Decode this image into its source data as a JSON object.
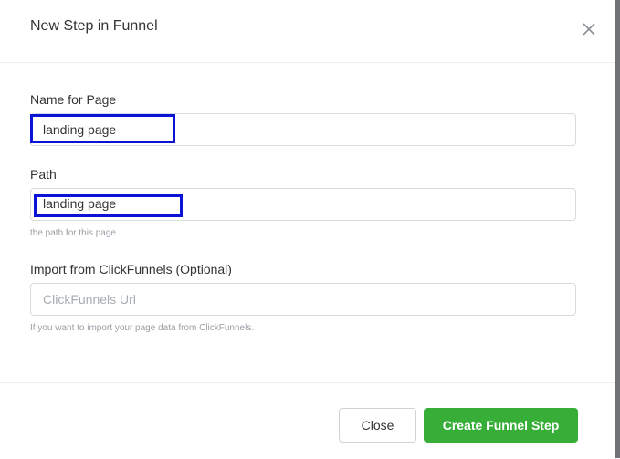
{
  "dialog": {
    "title": "New Step in Funnel"
  },
  "form": {
    "name": {
      "label": "Name for Page",
      "value": "landing page"
    },
    "path": {
      "label": "Path",
      "value": "landing page",
      "help": "the path for this page"
    },
    "import": {
      "label": "Import from ClickFunnels (Optional)",
      "placeholder": "ClickFunnels Url",
      "help": "If you want to import your page data from ClickFunnels."
    }
  },
  "footer": {
    "close_label": "Close",
    "create_label": "Create Funnel Step"
  },
  "colors": {
    "primary_button": "#37ae37",
    "highlight_box": "#0a13d6"
  },
  "icons": {
    "close": "close-icon"
  }
}
